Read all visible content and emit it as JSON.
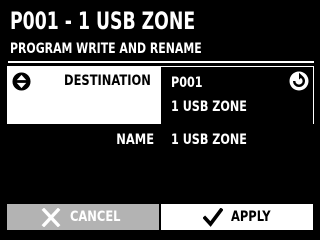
{
  "header": {
    "title": "P001 - 1 USB ZONE",
    "subtitle": "PROGRAM WRITE AND RENAME"
  },
  "destination": {
    "label": "DESTINATION",
    "selector_icon": "up-down-circle-icon",
    "program_number": "P001",
    "program_name": "1 USB ZONE",
    "action_icon": "rotate-circle-icon"
  },
  "name_field": {
    "label": "NAME",
    "value": "1 USB ZONE"
  },
  "footer": {
    "cancel_label": "CANCEL",
    "cancel_icon": "x-icon",
    "apply_label": "APPLY",
    "apply_icon": "checkmark-icon"
  },
  "colors": {
    "background": "#000000",
    "text": "#ffffff",
    "highlight": "#ffffff",
    "disabled_button": "#b3b3b3"
  }
}
